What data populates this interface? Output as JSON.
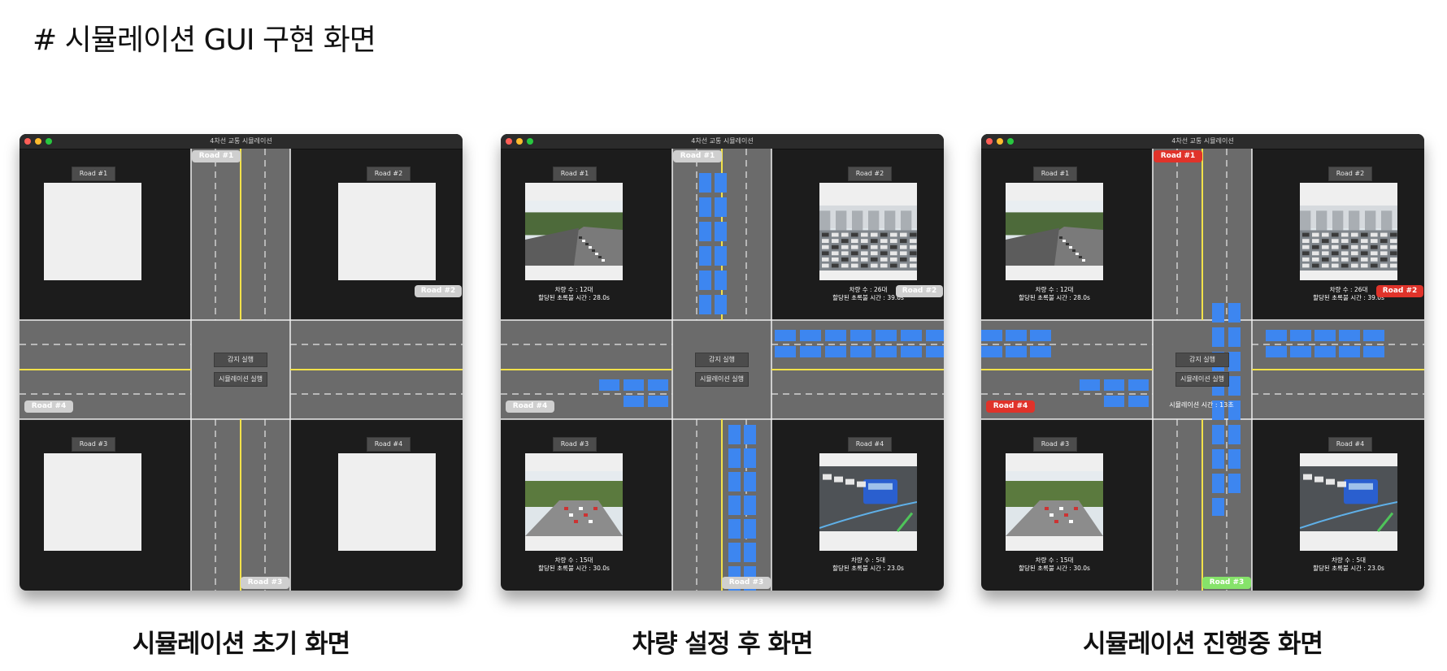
{
  "heading": "# 시뮬레이션 GUI 구현 화면",
  "window_title": "4차선 교통 시뮬레이션",
  "colors": {
    "window_bg": "#1c1c1c",
    "road_gray": "#6b6b6b",
    "lane_white": "#e8e8e8",
    "center_yellow": "#f2e24a",
    "car_blue": "#3d86f0",
    "tag_red": "#e0332a",
    "tag_green": "#86e36a",
    "tag_white": "#cfcfcf"
  },
  "buttons": {
    "detect": "감지 실행",
    "simulate": "시뮬레이션 실행"
  },
  "camera_labels": [
    "Road #1",
    "Road #2",
    "Road #3",
    "Road #4"
  ],
  "road_tags": [
    "Road #1",
    "Road #2",
    "Road #3",
    "Road #4"
  ],
  "stats": {
    "road1": {
      "count": "차량 수 : 12대",
      "green": "할당된 초록불 시간 : 28.0s"
    },
    "road2": {
      "count": "차량 수 : 26대",
      "green": "할당된 초록불 시간 : 39.0s"
    },
    "road3": {
      "count": "차량 수 : 15대",
      "green": "할당된 초록불 시간 : 30.0s"
    },
    "road4": {
      "count": "차량 수 : 5대",
      "green": "할당된 초록불 시간 : 23.0s"
    }
  },
  "timer_label": "시뮬레이션 시간 : 13초",
  "captions": [
    "시뮬레이션 초기 화면",
    "차량 설정 후 화면",
    "시뮬레이션 진행중 화면"
  ],
  "panels": [
    {
      "state": "initial",
      "photos": false,
      "tags": [
        "white",
        "white",
        "white",
        "white"
      ],
      "timer": false
    },
    {
      "state": "cars-set",
      "photos": true,
      "tags": [
        "white",
        "white",
        "white",
        "white"
      ],
      "timer": false
    },
    {
      "state": "running",
      "photos": true,
      "tags": [
        "red",
        "red",
        "green",
        "red"
      ],
      "timer": true
    }
  ]
}
